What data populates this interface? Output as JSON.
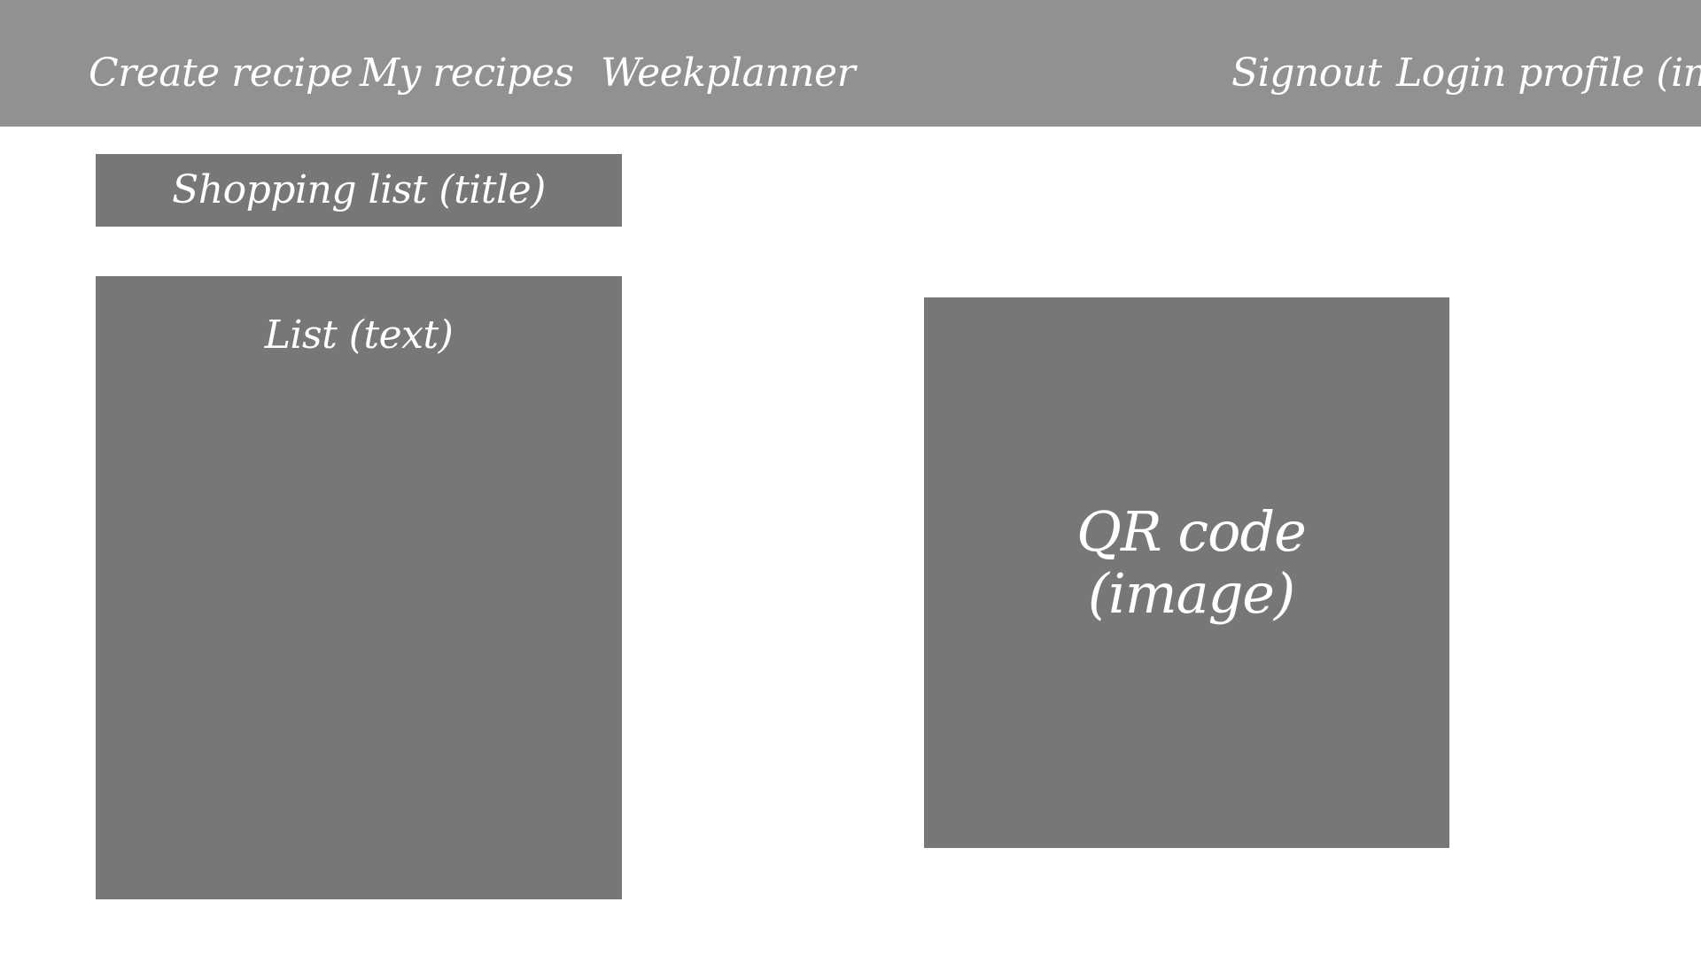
{
  "nav": {
    "create_recipe": "Create recipe",
    "my_recipes": "My recipes",
    "weekplanner": "Weekplanner",
    "signout": "Signout",
    "login_profile": "Login profile (img)"
  },
  "shopping_list": {
    "title": "Shopping list (title)",
    "list_text": "List (text)"
  },
  "qr_code": {
    "label": "QR code\n(image)"
  },
  "colors": {
    "nav_background": "#919191",
    "panel_background": "#777777",
    "text": "#ffffff",
    "page_background": "#ffffff"
  }
}
